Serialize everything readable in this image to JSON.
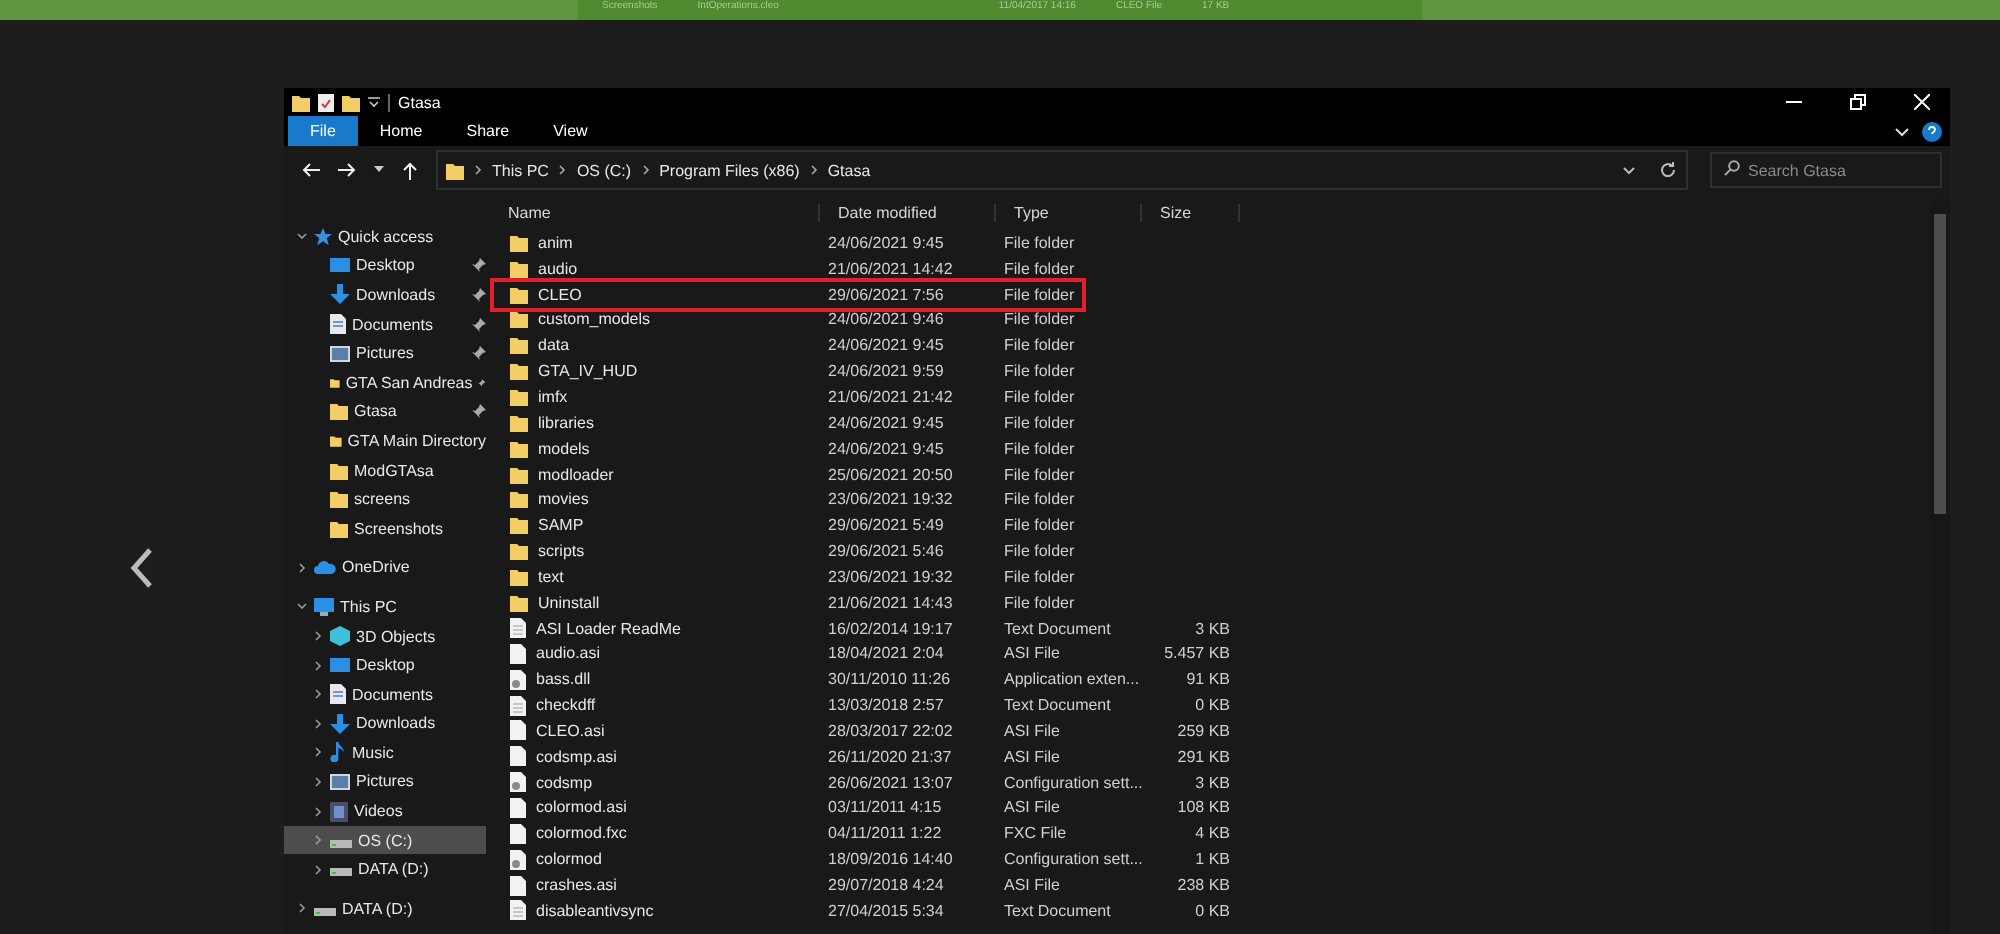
{
  "background_window": {
    "folder": "Screenshots",
    "file": "IntOperations.cleo",
    "date": "11/04/2017 14:16",
    "type": "CLEO File",
    "size": "17 KB"
  },
  "window": {
    "title": "Gtasa"
  },
  "ribbon_tabs": [
    {
      "label": "File",
      "selected": true
    },
    {
      "label": "Home",
      "selected": false
    },
    {
      "label": "Share",
      "selected": false
    },
    {
      "label": "View",
      "selected": false
    }
  ],
  "address": {
    "path": [
      "This PC",
      "OS (C:)",
      "Program Files (x86)",
      "Gtasa"
    ]
  },
  "search": {
    "placeholder": "Search Gtasa"
  },
  "sidebar": {
    "items": [
      {
        "label": "Quick access",
        "kind": "star",
        "expanded": true,
        "selected": false,
        "children": [
          {
            "label": "Desktop",
            "kind": "desktop",
            "pinned": true,
            "selected": false
          },
          {
            "label": "Downloads",
            "kind": "downloads",
            "pinned": true,
            "selected": false
          },
          {
            "label": "Documents",
            "kind": "documents",
            "pinned": true,
            "selected": false
          },
          {
            "label": "Pictures",
            "kind": "pictures",
            "pinned": true,
            "selected": false
          },
          {
            "label": "GTA San Andreas",
            "kind": "folder",
            "pinned": true,
            "selected": false
          },
          {
            "label": "Gtasa",
            "kind": "folder",
            "pinned": true,
            "selected": false
          },
          {
            "label": "GTA Main Directory",
            "kind": "folder",
            "pinned": false,
            "selected": false
          },
          {
            "label": "ModGTAsa",
            "kind": "folder",
            "pinned": false,
            "selected": false
          },
          {
            "label": "screens",
            "kind": "folder",
            "pinned": false,
            "selected": false
          },
          {
            "label": "Screenshots",
            "kind": "folder",
            "pinned": false,
            "selected": false
          }
        ]
      },
      {
        "label": "OneDrive",
        "kind": "cloud",
        "expanded": false,
        "selected": false
      },
      {
        "label": "This PC",
        "kind": "pc",
        "expanded": true,
        "selected": false,
        "children": [
          {
            "label": "3D Objects",
            "kind": "cube",
            "expanded": false,
            "selected": false
          },
          {
            "label": "Desktop",
            "kind": "desktop",
            "expanded": false,
            "selected": false
          },
          {
            "label": "Documents",
            "kind": "documents",
            "expanded": false,
            "selected": false
          },
          {
            "label": "Downloads",
            "kind": "downloads",
            "expanded": false,
            "selected": false
          },
          {
            "label": "Music",
            "kind": "music",
            "expanded": false,
            "selected": false
          },
          {
            "label": "Pictures",
            "kind": "pictures",
            "expanded": false,
            "selected": false
          },
          {
            "label": "Videos",
            "kind": "videos",
            "expanded": false,
            "selected": false
          },
          {
            "label": "OS (C:)",
            "kind": "drive",
            "expanded": false,
            "selected": true
          },
          {
            "label": "DATA (D:)",
            "kind": "drive",
            "expanded": false,
            "selected": false
          }
        ]
      },
      {
        "label": "DATA (D:)",
        "kind": "drive",
        "expanded": false,
        "selected": false
      }
    ]
  },
  "table": {
    "columns": [
      "Name",
      "Date modified",
      "Type",
      "Size"
    ],
    "rows": [
      {
        "kind": "folder",
        "name": "anim",
        "date": "24/06/2021 9:45",
        "type": "File folder",
        "highlighted": false
      },
      {
        "kind": "folder",
        "name": "audio",
        "date": "21/06/2021 14:42",
        "type": "File folder",
        "highlighted": false
      },
      {
        "kind": "folder",
        "name": "CLEO",
        "date": "29/06/2021 7:56",
        "type": "File folder",
        "highlighted": true
      },
      {
        "kind": "folder",
        "name": "custom_models",
        "date": "24/06/2021 9:46",
        "type": "File folder",
        "highlighted": false
      },
      {
        "kind": "folder",
        "name": "data",
        "date": "24/06/2021 9:45",
        "type": "File folder",
        "highlighted": false
      },
      {
        "kind": "folder",
        "name": "GTA_IV_HUD",
        "date": "24/06/2021 9:59",
        "type": "File folder",
        "highlighted": false
      },
      {
        "kind": "folder",
        "name": "imfx",
        "date": "21/06/2021 21:42",
        "type": "File folder",
        "highlighted": false
      },
      {
        "kind": "folder",
        "name": "libraries",
        "date": "24/06/2021 9:45",
        "type": "File folder",
        "highlighted": false
      },
      {
        "kind": "folder",
        "name": "models",
        "date": "24/06/2021 9:45",
        "type": "File folder",
        "highlighted": false
      },
      {
        "kind": "folder",
        "name": "modloader",
        "date": "25/06/2021 20:50",
        "type": "File folder",
        "highlighted": false
      },
      {
        "kind": "folder",
        "name": "movies",
        "date": "23/06/2021 19:32",
        "type": "File folder",
        "highlighted": false
      },
      {
        "kind": "folder",
        "name": "SAMP",
        "date": "29/06/2021 5:49",
        "type": "File folder",
        "highlighted": false
      },
      {
        "kind": "folder",
        "name": "scripts",
        "date": "29/06/2021 5:46",
        "type": "File folder",
        "highlighted": false
      },
      {
        "kind": "folder",
        "name": "text",
        "date": "23/06/2021 19:32",
        "type": "File folder",
        "highlighted": false
      },
      {
        "kind": "folder",
        "name": "Uninstall",
        "date": "21/06/2021 14:43",
        "type": "File folder",
        "highlighted": false
      },
      {
        "kind": "text",
        "name": "ASI Loader ReadMe",
        "date": "16/02/2014 19:17",
        "type": "Text Document",
        "size": "3 KB",
        "highlighted": false
      },
      {
        "kind": "file",
        "name": "audio.asi",
        "date": "18/04/2021 2:04",
        "type": "ASI File",
        "size": "5.457 KB",
        "highlighted": false
      },
      {
        "kind": "config",
        "name": "bass.dll",
        "date": "30/11/2010 11:26",
        "type": "Application exten...",
        "size": "91 KB",
        "highlighted": false
      },
      {
        "kind": "text",
        "name": "checkdff",
        "date": "13/03/2018 2:57",
        "type": "Text Document",
        "size": "0 KB",
        "highlighted": false
      },
      {
        "kind": "file",
        "name": "CLEO.asi",
        "date": "28/03/2017 22:02",
        "type": "ASI File",
        "size": "259 KB",
        "highlighted": false
      },
      {
        "kind": "file",
        "name": "codsmp.asi",
        "date": "26/11/2020 21:37",
        "type": "ASI File",
        "size": "291 KB",
        "highlighted": false
      },
      {
        "kind": "config",
        "name": "codsmp",
        "date": "26/06/2021 13:07",
        "type": "Configuration sett...",
        "size": "3 KB",
        "highlighted": false
      },
      {
        "kind": "file",
        "name": "colormod.asi",
        "date": "03/11/2011 4:15",
        "type": "ASI File",
        "size": "108 KB",
        "highlighted": false
      },
      {
        "kind": "file",
        "name": "colormod.fxc",
        "date": "04/11/2011 1:22",
        "type": "FXC File",
        "size": "4 KB",
        "highlighted": false
      },
      {
        "kind": "config",
        "name": "colormod",
        "date": "18/09/2016 14:40",
        "type": "Configuration sett...",
        "size": "1 KB",
        "highlighted": false
      },
      {
        "kind": "file",
        "name": "crashes.asi",
        "date": "29/07/2018 4:24",
        "type": "ASI File",
        "size": "238 KB",
        "highlighted": false
      },
      {
        "kind": "text",
        "name": "disableantivsync",
        "date": "27/04/2015 5:34",
        "type": "Text Document",
        "size": "0 KB",
        "highlighted": false
      }
    ]
  }
}
